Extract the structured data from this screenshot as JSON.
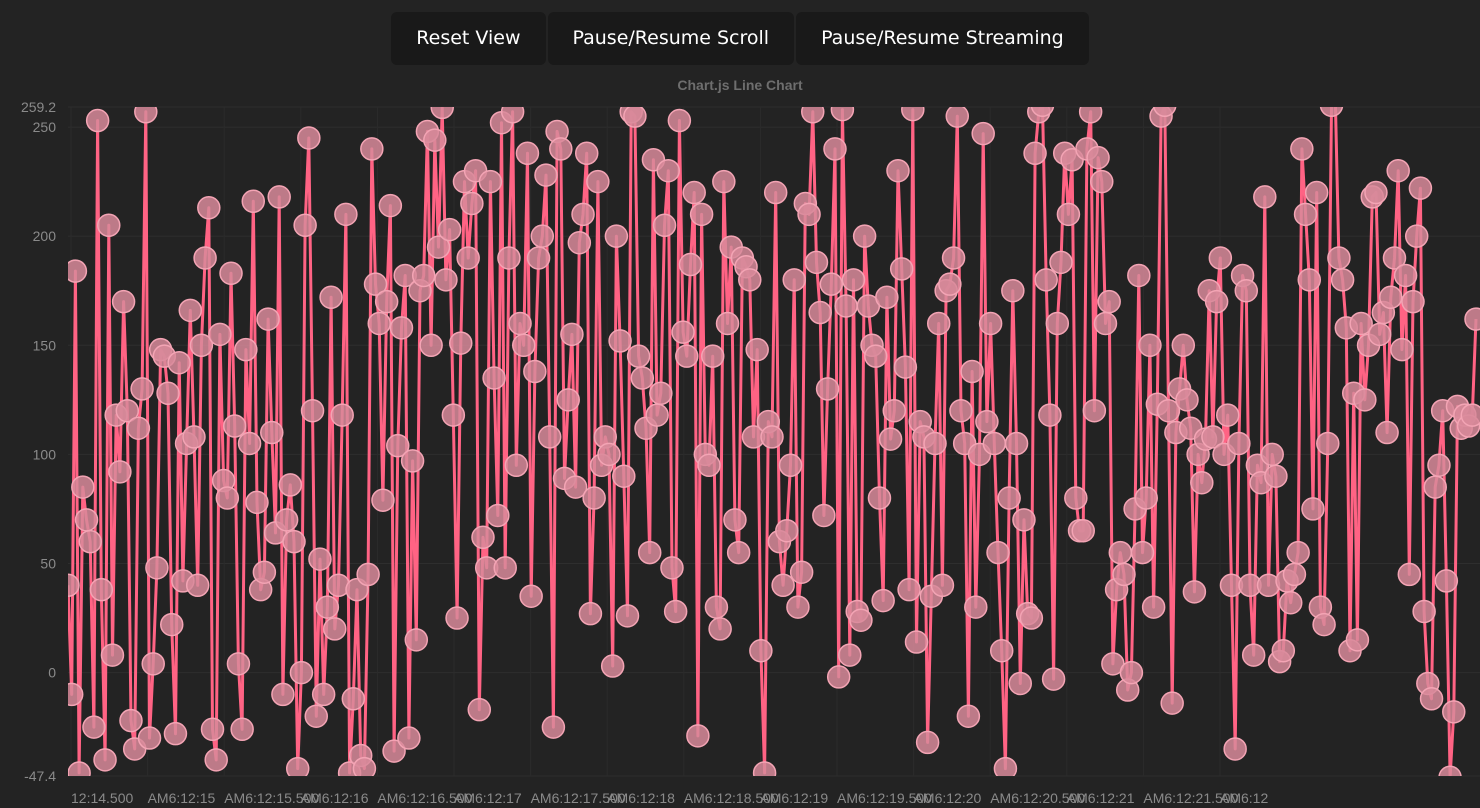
{
  "toolbar": {
    "reset_label": "Reset View",
    "scroll_label": "Pause/Resume Scroll",
    "stream_label": "Pause/Resume Streaming"
  },
  "chart_data": {
    "type": "line",
    "title": "Chart.js Line Chart",
    "ylim": [
      -47.4,
      259.2
    ],
    "grid": true,
    "legend": "none",
    "y_ticks": [
      "259.2",
      "250",
      "200",
      "150",
      "100",
      "50",
      "0",
      "-47.4"
    ],
    "x_ticks": [
      "12:14.500",
      "AM6:12:15",
      "AM6:12:15.500",
      "AM6:12:16",
      "AM6:12:16.500",
      "AM6:12:17",
      "AM6:12:17.500",
      "AM6:12:18",
      "AM6:12:18.500",
      "AM6:12:19",
      "AM6:12:19.500",
      "AM6:12:20",
      "AM6:12:20.500",
      "AM6:12:21",
      "AM6:12:21.500",
      "AM6:12"
    ],
    "series": [
      {
        "color": "#ff6384",
        "point_color": "#d88a9a",
        "values": [
          40,
          -10,
          184,
          -46,
          85,
          70,
          60,
          -25,
          253,
          38,
          -40,
          205,
          8,
          118,
          92,
          170,
          120,
          -22,
          -35,
          112,
          130,
          257,
          -30,
          4,
          48,
          148,
          145,
          128,
          22,
          -28,
          142,
          42,
          105,
          166,
          108,
          40,
          150,
          190,
          213,
          -26,
          -40,
          155,
          88,
          80,
          183,
          113,
          4,
          -26,
          148,
          105,
          216,
          78,
          38,
          46,
          162,
          110,
          64,
          218,
          -10,
          70,
          86,
          60,
          -44,
          0,
          205,
          245,
          120,
          -20,
          52,
          -10,
          30,
          172,
          20,
          40,
          118,
          210,
          -46,
          -12,
          38,
          -38,
          -44,
          45,
          240,
          178,
          160,
          79,
          170,
          214,
          -36,
          104,
          158,
          182,
          -30,
          97,
          15,
          175,
          182,
          248,
          150,
          244,
          195,
          259,
          180,
          203,
          118,
          25,
          151,
          225,
          190,
          215,
          230,
          -17,
          62,
          48,
          225,
          135,
          72,
          252,
          48,
          190,
          257,
          95,
          160,
          150,
          238,
          35,
          138,
          190,
          200,
          228,
          108,
          -25,
          248,
          240,
          89,
          125,
          155,
          85,
          197,
          210,
          238,
          27,
          80,
          225,
          95,
          108,
          100,
          3,
          200,
          152,
          90,
          26,
          257,
          255,
          145,
          135,
          112,
          55,
          235,
          118,
          128,
          205,
          230,
          48,
          28,
          253,
          156,
          145,
          187,
          220,
          -29,
          210,
          100,
          95,
          145,
          30,
          20,
          225,
          160,
          195,
          70,
          55,
          190,
          186,
          180,
          108,
          148,
          10,
          -46,
          115,
          108,
          220,
          60,
          40,
          65,
          95,
          180,
          30,
          46,
          215,
          210,
          257,
          188,
          165,
          72,
          130,
          178,
          240,
          -2,
          258,
          168,
          8,
          180,
          28,
          24,
          200,
          168,
          150,
          145,
          80,
          33,
          172,
          107,
          120,
          230,
          185,
          140,
          38,
          258,
          14,
          115,
          108,
          -32,
          35,
          105,
          160,
          40,
          175,
          178,
          190,
          255,
          120,
          105,
          -20,
          138,
          30,
          100,
          247,
          115,
          160,
          105,
          55,
          10,
          -44,
          80,
          175,
          105,
          -5,
          70,
          27,
          25,
          238,
          257,
          260,
          180,
          118,
          -3,
          160,
          188,
          238,
          210,
          235,
          80,
          65,
          65,
          240,
          257,
          120,
          236,
          225,
          160,
          170,
          4,
          38,
          55,
          45,
          -8,
          0,
          75,
          182,
          55,
          80,
          150,
          30,
          123,
          255,
          260,
          120,
          -14,
          110,
          130,
          150,
          125,
          112,
          37,
          100,
          87,
          107,
          175,
          108,
          170,
          190,
          100,
          118,
          40,
          -35,
          105,
          182,
          175,
          40,
          8,
          95,
          87,
          218,
          40,
          100,
          90,
          5,
          10,
          42,
          32,
          45,
          55,
          240,
          210,
          180,
          75,
          220,
          30,
          22,
          105,
          260,
          265,
          190,
          180,
          158,
          10,
          128,
          15,
          160,
          125,
          150,
          218,
          220,
          155,
          165,
          110,
          172,
          190,
          230,
          148,
          182,
          45,
          170,
          200,
          222,
          28,
          -5,
          -12,
          85,
          95,
          120,
          42,
          -48,
          -18,
          122,
          112,
          118,
          113,
          118,
          162
        ]
      }
    ]
  }
}
